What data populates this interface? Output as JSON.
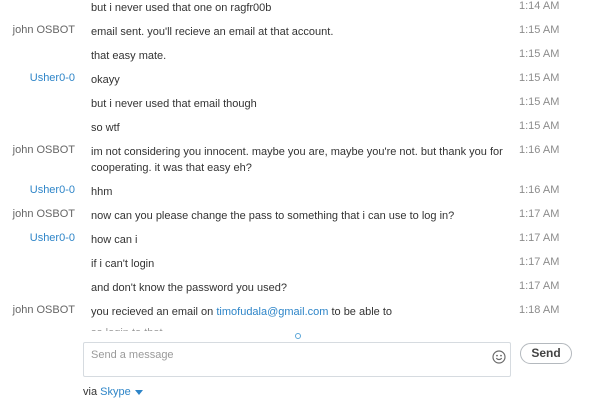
{
  "messages": [
    {
      "sender": "",
      "text": "but i never used that one on ragfr00b",
      "time": "1:14 AM"
    },
    {
      "sender": "john OSBOT",
      "text": "email sent. you'll recieve an email at that account.",
      "time": "1:15 AM"
    },
    {
      "sender": "",
      "text": "that easy mate.",
      "time": "1:15 AM"
    },
    {
      "sender": "Usher0-0",
      "text": "okayy",
      "time": "1:15 AM"
    },
    {
      "sender": "",
      "text": "but i never used that email though",
      "time": "1:15 AM"
    },
    {
      "sender": "",
      "text": "so wtf",
      "time": "1:15 AM"
    },
    {
      "sender": "john OSBOT",
      "text": "im not considering you innocent. maybe you are, maybe you're not. but thank you for cooperating. it was that easy eh?",
      "time": "1:16 AM"
    },
    {
      "sender": "Usher0-0",
      "text": "hhm",
      "time": "1:16 AM"
    },
    {
      "sender": "john OSBOT",
      "text": "now can you please change the pass to something that i can use to log in?",
      "time": "1:17 AM"
    },
    {
      "sender": "Usher0-0",
      "text": "how can i",
      "time": "1:17 AM"
    },
    {
      "sender": "",
      "text": "if i can't login",
      "time": "1:17 AM"
    },
    {
      "sender": "",
      "text": "and don't know the password you used?",
      "time": "1:17 AM"
    },
    {
      "sender": "john OSBOT",
      "text_before": "you recieved an email on ",
      "link": "timofudala@gmail.com",
      "text_after": " to be able to",
      "time": "1:18 AM"
    }
  ],
  "partial_line": "so login to that email",
  "composer": {
    "placeholder": "Send a message",
    "value": "",
    "emoticon_icon": "smiley-icon",
    "send_label": "Send"
  },
  "footer": {
    "via_label": "via",
    "service_label": "Skype",
    "dropdown_icon": "caret-down-icon"
  },
  "colors": {
    "sender_john": "#666666",
    "sender_usher": "#2e85c8",
    "link": "#2e85c8",
    "time": "#8c8c8c",
    "text": "#333333"
  }
}
